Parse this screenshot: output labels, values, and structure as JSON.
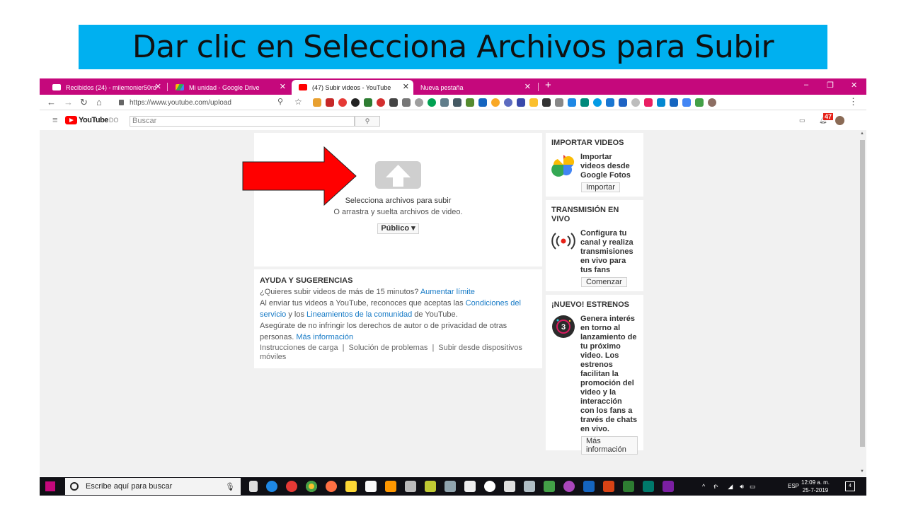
{
  "slide": {
    "title_prefix": "Dar clic en",
    "title_bold": "Selecciona Archivos para Subir",
    "bg_color": "#00b0f0"
  },
  "browser": {
    "accent": "#c5087c",
    "tabs": [
      {
        "label": "Recibidos (24) - milemonier50rd",
        "icon": "gmail-icon"
      },
      {
        "label": "Mi unidad - Google Drive",
        "icon": "drive-icon"
      },
      {
        "label": "(47) Subir videos - YouTube",
        "icon": "youtube-icon"
      },
      {
        "label": "Nueva pestaña",
        "icon": ""
      }
    ],
    "new_tab": "+",
    "window_controls": [
      "–",
      "❐",
      "✕"
    ],
    "url": "https://www.youtube.com/upload"
  },
  "youtube": {
    "logo_text": "YouTube",
    "region": "DO",
    "search_placeholder": "Buscar",
    "notification_count": "47"
  },
  "upload": {
    "main_text": "Selecciona archivos para subir",
    "sub_text": "O arrastra y suelta archivos de video.",
    "privacy_label": "Público ▾"
  },
  "help": {
    "title": "AYUDA Y SUGERENCIAS",
    "line1_text": "¿Quieres subir videos de más de 15 minutos? ",
    "line1_link": "Aumentar límite",
    "line2_text": "Al enviar tus videos a YouTube, reconoces que aceptas las ",
    "line2_link1": "Condiciones del servicio",
    "line2_mid": " y los ",
    "line2_link2": "Lineamientos de la comunidad",
    "line2_end": " de YouTube.",
    "line3_text": "Asegúrate de no infringir los derechos de autor o de privacidad de otras personas. ",
    "line3_link": "Más información",
    "links": [
      "Instrucciones de carga",
      "Solución de problemas",
      "Subir desde dispositivos móviles"
    ]
  },
  "side": {
    "import": {
      "title": "IMPORTAR VIDEOS",
      "text": "Importar videos desde Google Fotos",
      "button": "Importar"
    },
    "live": {
      "title": "TRANSMISIÓN EN VIVO",
      "text": "Configura tu canal y realiza transmisiones en vivo para tus fans",
      "button": "Comenzar"
    },
    "premieres": {
      "title": "¡NUEVO! ESTRENOS",
      "text": "Genera interés en torno al lanzamiento de tu próximo video. Los estrenos facilitan la promoción del video y la interacción con los fans a través de chats en vivo.",
      "button": "Más información"
    }
  },
  "taskbar": {
    "search_placeholder": "Escribe aquí para buscar",
    "language": "ESP",
    "time": "12:09 a. m.",
    "date": "25-7-2019",
    "notif_count": "4"
  }
}
